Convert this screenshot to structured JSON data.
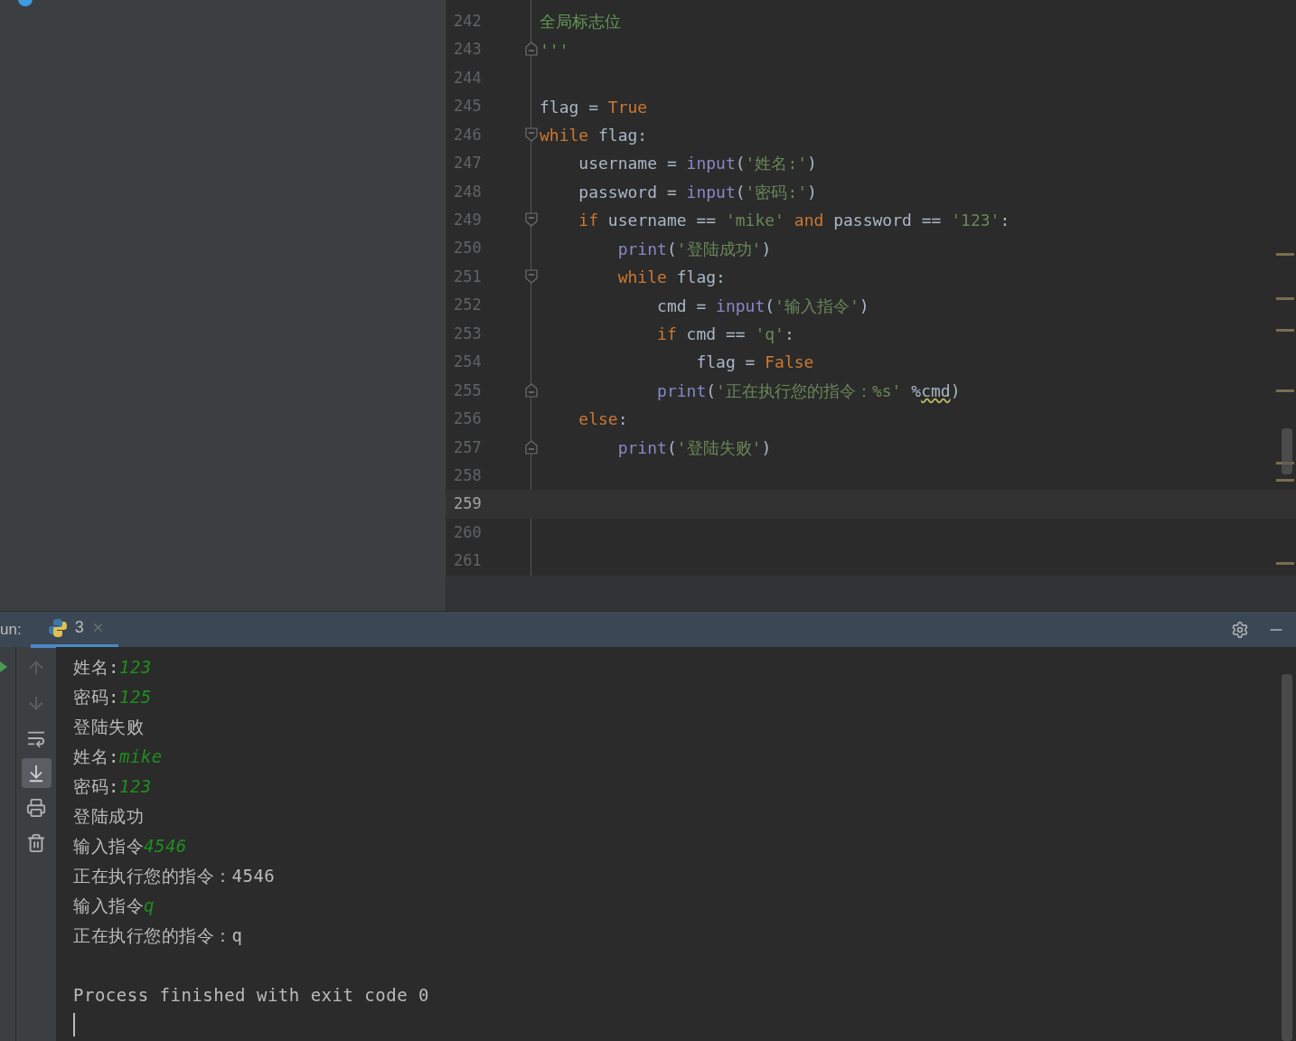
{
  "editor": {
    "lines": [
      {
        "number": "242",
        "current": false,
        "tokens": [
          {
            "kind": "doc",
            "text": "全局标志位"
          }
        ]
      },
      {
        "number": "243",
        "current": false,
        "fold_end": true,
        "tokens": [
          {
            "kind": "doc",
            "text": "'''"
          }
        ]
      },
      {
        "number": "244",
        "current": false
      },
      {
        "number": "245",
        "current": false,
        "tokens": [
          {
            "kind": "plain",
            "text": "flag = "
          },
          {
            "kind": "keyword",
            "text": "True"
          }
        ]
      },
      {
        "number": "246",
        "current": false,
        "fold_start": true,
        "tokens": [
          {
            "kind": "keyword",
            "text": "while"
          },
          {
            "kind": "plain",
            "text": " flag:"
          }
        ]
      },
      {
        "number": "247",
        "current": false,
        "tokens": [
          {
            "kind": "plain",
            "text": "    username = "
          },
          {
            "kind": "builtin",
            "text": "input"
          },
          {
            "kind": "plain",
            "text": "("
          },
          {
            "kind": "string",
            "text": "'姓名:'"
          },
          {
            "kind": "plain",
            "text": ")"
          }
        ]
      },
      {
        "number": "248",
        "current": false,
        "tokens": [
          {
            "kind": "plain",
            "text": "    password = "
          },
          {
            "kind": "builtin",
            "text": "input"
          },
          {
            "kind": "plain",
            "text": "("
          },
          {
            "kind": "string",
            "text": "'密码:'"
          },
          {
            "kind": "plain",
            "text": ")"
          }
        ]
      },
      {
        "number": "249",
        "current": false,
        "fold_start": true,
        "tokens": [
          {
            "kind": "keyword",
            "text": "    if"
          },
          {
            "kind": "plain",
            "text": " username == "
          },
          {
            "kind": "string",
            "text": "'mike'"
          },
          {
            "kind": "keyword",
            "text": " and"
          },
          {
            "kind": "plain",
            "text": " password == "
          },
          {
            "kind": "string",
            "text": "'123'"
          },
          {
            "kind": "plain",
            "text": ":"
          }
        ]
      },
      {
        "number": "250",
        "current": false,
        "tokens": [
          {
            "kind": "builtin",
            "text": "        print"
          },
          {
            "kind": "plain",
            "text": "("
          },
          {
            "kind": "string",
            "text": "'登陆成功'"
          },
          {
            "kind": "plain",
            "text": ")"
          }
        ]
      },
      {
        "number": "251",
        "current": false,
        "fold_start": true,
        "tokens": [
          {
            "kind": "keyword",
            "text": "        while"
          },
          {
            "kind": "plain",
            "text": " flag:"
          }
        ]
      },
      {
        "number": "252",
        "current": false,
        "tokens": [
          {
            "kind": "plain",
            "text": "            cmd = "
          },
          {
            "kind": "builtin",
            "text": "input"
          },
          {
            "kind": "plain",
            "text": "("
          },
          {
            "kind": "string",
            "text": "'输入指令'"
          },
          {
            "kind": "plain",
            "text": ")"
          }
        ]
      },
      {
        "number": "253",
        "current": false,
        "tokens": [
          {
            "kind": "keyword",
            "text": "            if"
          },
          {
            "kind": "plain",
            "text": " cmd == "
          },
          {
            "kind": "string",
            "text": "'q'"
          },
          {
            "kind": "plain",
            "text": ":"
          }
        ]
      },
      {
        "number": "254",
        "current": false,
        "tokens": [
          {
            "kind": "plain",
            "text": "                flag = "
          },
          {
            "kind": "keyword",
            "text": "False"
          }
        ]
      },
      {
        "number": "255",
        "current": false,
        "fold_end": true,
        "tokens": [
          {
            "kind": "builtin",
            "text": "            print"
          },
          {
            "kind": "plain",
            "text": "("
          },
          {
            "kind": "string",
            "text": "'正在执行您的指令：%s'"
          },
          {
            "kind": "plain",
            "text": " %"
          },
          {
            "kind": "warning",
            "text": "cmd"
          },
          {
            "kind": "plain",
            "text": ")"
          }
        ]
      },
      {
        "number": "256",
        "current": false,
        "tokens": [
          {
            "kind": "keyword",
            "text": "    else"
          },
          {
            "kind": "plain",
            "text": ":"
          }
        ]
      },
      {
        "number": "257",
        "current": false,
        "fold_end": true,
        "tokens": [
          {
            "kind": "builtin",
            "text": "        print"
          },
          {
            "kind": "plain",
            "text": "("
          },
          {
            "kind": "string",
            "text": "'登陆失败'"
          },
          {
            "kind": "plain",
            "text": ")"
          }
        ]
      },
      {
        "number": "258",
        "current": false
      },
      {
        "number": "259",
        "current": true
      },
      {
        "number": "260",
        "current": false
      },
      {
        "number": "261",
        "current": false
      }
    ]
  },
  "run_panel": {
    "label": "un:",
    "tabs": [
      {
        "label": "3",
        "selected": true
      }
    ],
    "console": [
      {
        "segments": [
          {
            "kind": "output",
            "text": "姓名:"
          },
          {
            "kind": "input",
            "text": "123"
          }
        ]
      },
      {
        "segments": [
          {
            "kind": "output",
            "text": "密码:"
          },
          {
            "kind": "input",
            "text": "125"
          }
        ]
      },
      {
        "segments": [
          {
            "kind": "output",
            "text": "登陆失败"
          }
        ]
      },
      {
        "segments": [
          {
            "kind": "output",
            "text": "姓名:"
          },
          {
            "kind": "input",
            "text": "mike"
          }
        ]
      },
      {
        "segments": [
          {
            "kind": "output",
            "text": "密码:"
          },
          {
            "kind": "input",
            "text": "123"
          }
        ]
      },
      {
        "segments": [
          {
            "kind": "output",
            "text": "登陆成功"
          }
        ]
      },
      {
        "segments": [
          {
            "kind": "output",
            "text": "输入指令"
          },
          {
            "kind": "input",
            "text": "4546"
          }
        ]
      },
      {
        "segments": [
          {
            "kind": "output",
            "text": "正在执行您的指令：4546"
          }
        ]
      },
      {
        "segments": [
          {
            "kind": "output",
            "text": "输入指令"
          },
          {
            "kind": "input",
            "text": "q"
          }
        ]
      },
      {
        "segments": [
          {
            "kind": "output",
            "text": "正在执行您的指令：q"
          }
        ]
      },
      {
        "kind": "blank"
      },
      {
        "segments": [
          {
            "kind": "output",
            "text": "Process finished with exit code 0"
          }
        ]
      }
    ]
  }
}
